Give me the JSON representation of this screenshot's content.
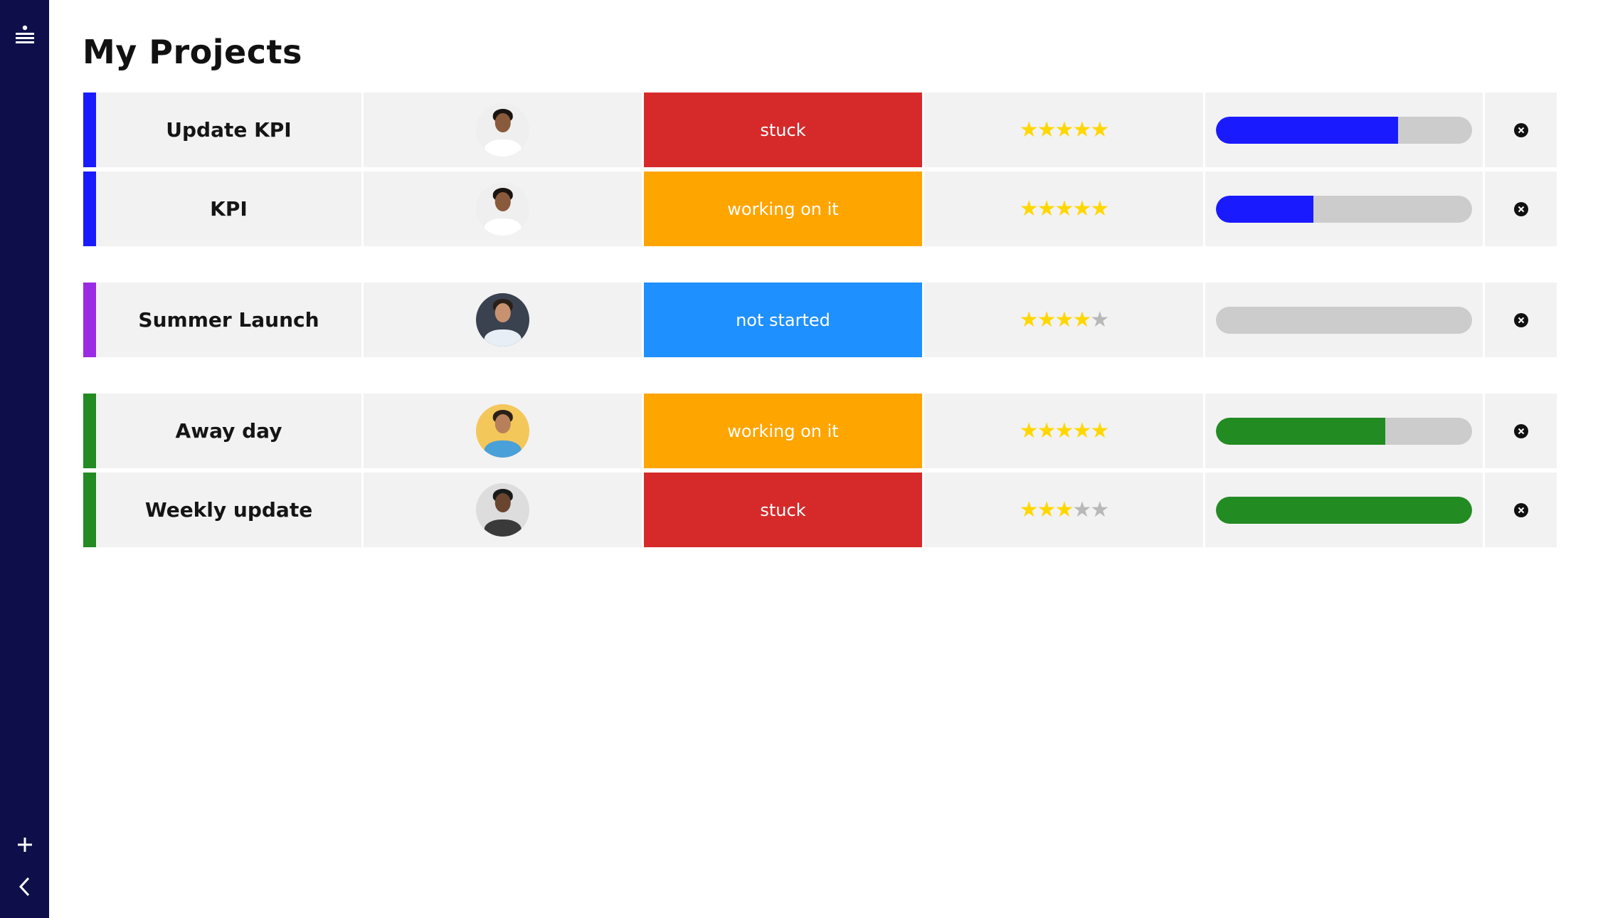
{
  "sidebar": {
    "menu_icon": "menu-icon",
    "add_icon": "plus-icon",
    "collapse_icon": "chevron-left-icon",
    "background": "#0e0f4a"
  },
  "page": {
    "title": "My Projects"
  },
  "groups": [
    {
      "color": "#1a1aff",
      "rows": [
        {
          "name": "Update KPI",
          "person": "woman-curly-hair",
          "status": "stuck",
          "status_color": "#d62a2a",
          "rating": 5,
          "progress": 0.71
        },
        {
          "name": "KPI",
          "person": "woman-curly-hair",
          "status": "working on it",
          "status_color": "#ffa500",
          "rating": 5,
          "progress": 0.38
        }
      ]
    },
    {
      "color": "#9b2be3",
      "rows": [
        {
          "name": "Summer Launch",
          "person": "man-beard-smiling",
          "status": "not started",
          "status_color": "#1e90ff",
          "rating": 4,
          "progress": 0
        }
      ]
    },
    {
      "color": "#228b22",
      "rows": [
        {
          "name": "Away day",
          "person": "man-blue-shirt",
          "status": "working on it",
          "status_color": "#ffa500",
          "rating": 5,
          "progress": 0.66
        },
        {
          "name": "Weekly update",
          "person": "man-laughing",
          "status": "stuck",
          "status_color": "#d62a2a",
          "rating": 3,
          "progress": 1.0
        }
      ]
    }
  ]
}
